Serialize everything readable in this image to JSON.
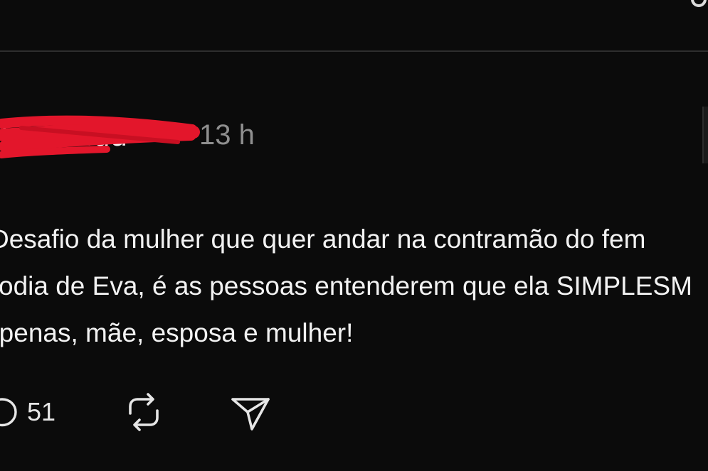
{
  "post": {
    "username": "fernanda",
    "timestamp": "13 h",
    "body_lines": [
      "Desafio da mulher que quer andar na contramão do fem",
      "odia de Eva, é as pessoas entenderem que ela SIMPLESM",
      "Apenas, mãe, esposa e mulher!"
    ],
    "reply_count": "51"
  },
  "colors": {
    "background": "#0b0b0b",
    "text": "#f2f2f2",
    "muted": "#8f8f8f",
    "redaction": "#e3162b",
    "divider": "#2e2e2e"
  },
  "icons": {
    "reply": "reply-bubble-icon",
    "repost": "repost-icon",
    "share": "send-icon",
    "corner": "more-icon"
  }
}
